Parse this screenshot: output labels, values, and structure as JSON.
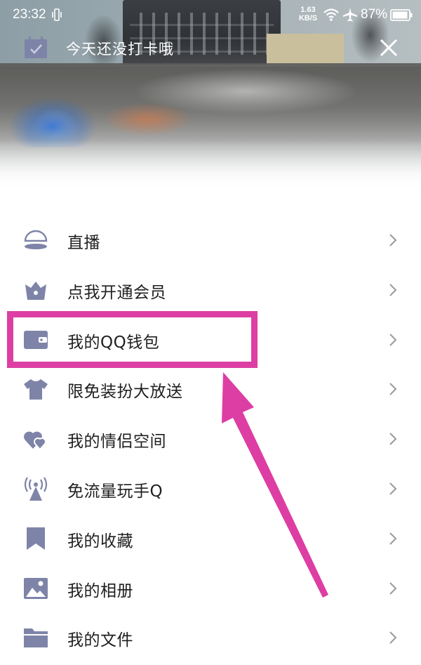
{
  "status_bar": {
    "time": "23:32",
    "net_speed_value": "1.63",
    "net_speed_unit": "KB/S",
    "battery": "87%",
    "icons": [
      "vibrate-icon",
      "wifi-icon",
      "airplane-icon",
      "battery-icon"
    ]
  },
  "checkin": {
    "text": "今天还没打卡哦",
    "icon": "calendar-check-icon",
    "close_icon": "close-icon"
  },
  "menu": {
    "items": [
      {
        "label": "直播",
        "icon": "live-icon"
      },
      {
        "label": "点我开通会员",
        "icon": "crown-icon"
      },
      {
        "label": "我的QQ钱包",
        "icon": "wallet-icon"
      },
      {
        "label": "限免装扮大放送",
        "icon": "tshirt-icon"
      },
      {
        "label": "我的情侣空间",
        "icon": "hearts-icon"
      },
      {
        "label": "免流量玩手Q",
        "icon": "antenna-icon"
      },
      {
        "label": "我的收藏",
        "icon": "bookmark-icon"
      },
      {
        "label": "我的相册",
        "icon": "photo-icon"
      },
      {
        "label": "我的文件",
        "icon": "folder-icon"
      }
    ]
  },
  "colors": {
    "icon": "#7e84a8",
    "annotation": "#dd3ea3",
    "label": "#1f1f1f",
    "chevron": "#9a9a9a"
  }
}
